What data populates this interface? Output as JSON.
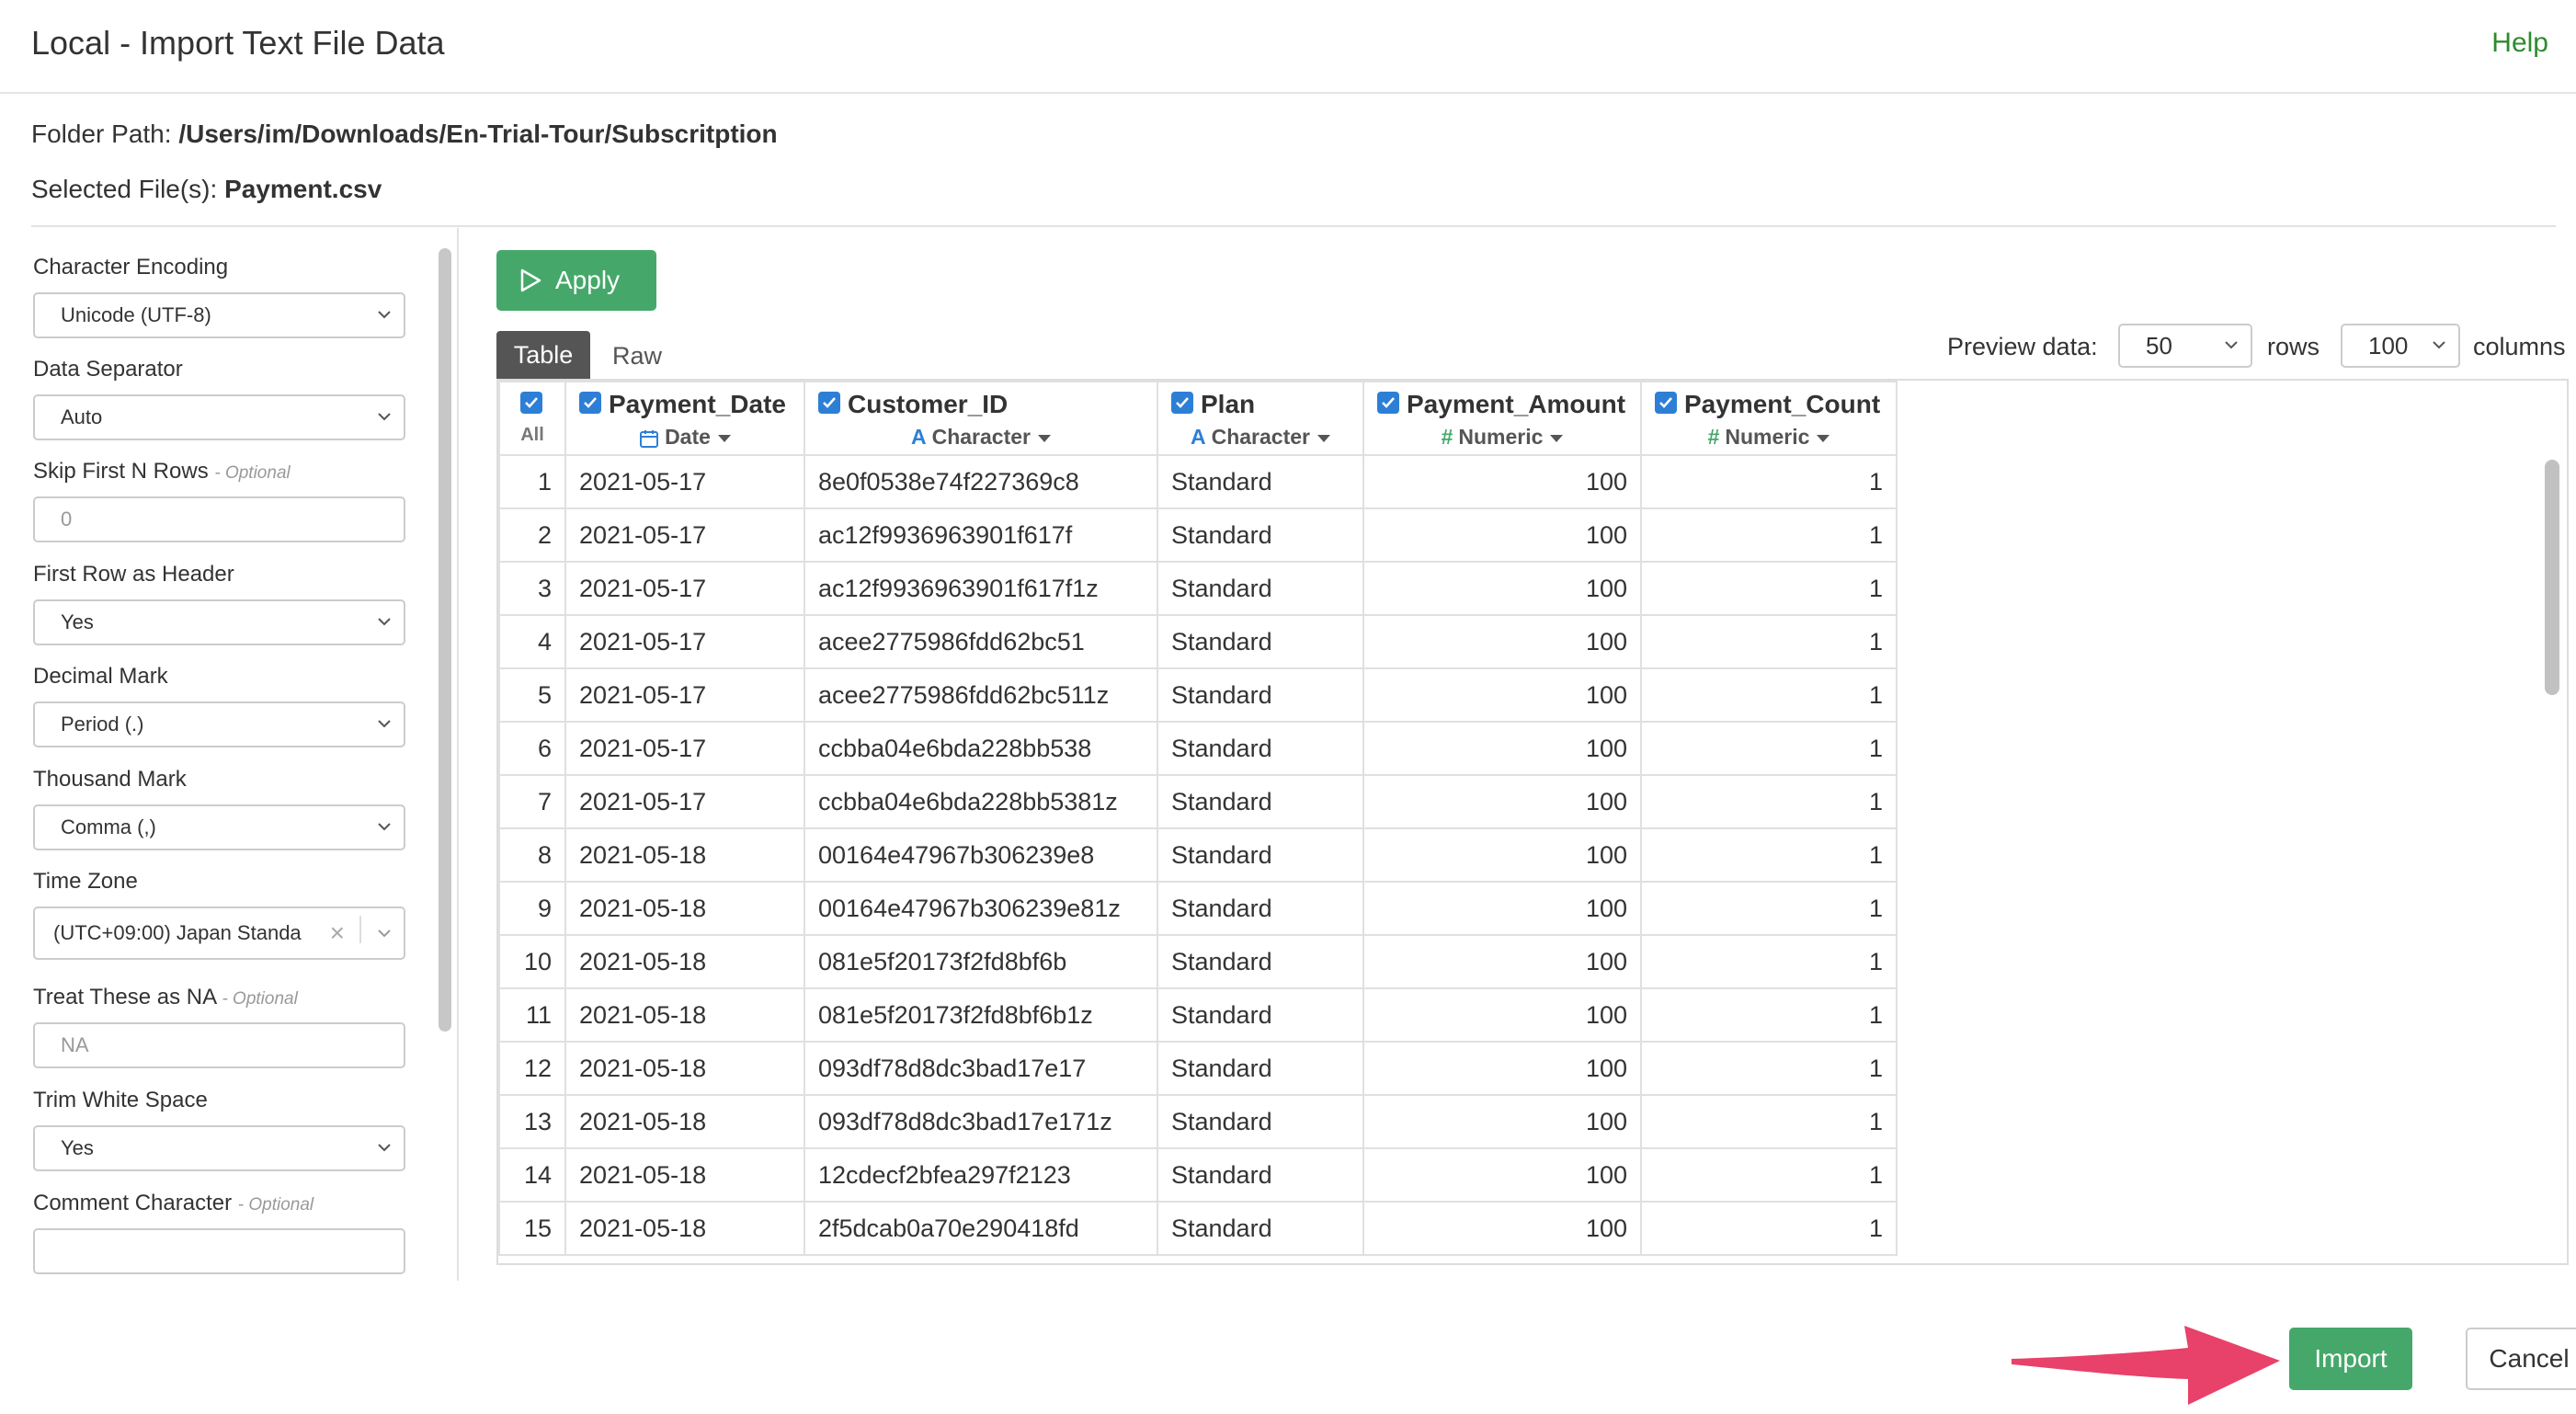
{
  "header": {
    "title": "Local - Import Text File Data",
    "help": "Help"
  },
  "info": {
    "folder_label": "Folder Path:",
    "folder_value": "/Users/im/Downloads/En-Trial-Tour/Subscritption",
    "file_label": "Selected File(s):",
    "file_value": "Payment.csv"
  },
  "options": {
    "encoding": {
      "label": "Character Encoding",
      "value": "Unicode (UTF-8)"
    },
    "separator": {
      "label": "Data Separator",
      "value": "Auto"
    },
    "skip": {
      "label": "Skip First N Rows",
      "optional": "- Optional",
      "placeholder": "0"
    },
    "header_row": {
      "label": "First Row as Header",
      "value": "Yes"
    },
    "decimal": {
      "label": "Decimal Mark",
      "value": "Period (.)"
    },
    "thousand": {
      "label": "Thousand Mark",
      "value": "Comma (,)"
    },
    "timezone": {
      "label": "Time Zone",
      "value": "(UTC+09:00) Japan Standa"
    },
    "na": {
      "label": "Treat These as NA",
      "optional": "- Optional",
      "placeholder": "NA"
    },
    "trim": {
      "label": "Trim White Space",
      "value": "Yes"
    },
    "comment": {
      "label": "Comment Character",
      "optional": "- Optional",
      "placeholder": ""
    }
  },
  "toolbar": {
    "apply": "Apply",
    "tab_table": "Table",
    "tab_raw": "Raw"
  },
  "preview": {
    "label": "Preview data:",
    "rows_value": "50",
    "rows_label": "rows",
    "cols_value": "100",
    "cols_label": "columns"
  },
  "grid": {
    "all_label": "All",
    "columns": [
      {
        "name": "Payment_Date",
        "type": "Date",
        "icon": "calendar-icon"
      },
      {
        "name": "Customer_ID",
        "type": "Character",
        "icon": "character-type-icon"
      },
      {
        "name": "Plan",
        "type": "Character",
        "icon": "character-type-icon"
      },
      {
        "name": "Payment_Amount",
        "type": "Numeric",
        "icon": "numeric-type-icon"
      },
      {
        "name": "Payment_Count",
        "type": "Numeric",
        "icon": "numeric-type-icon"
      }
    ],
    "rows": [
      [
        "1",
        "2021-05-17",
        "8e0f0538e74f227369c8",
        "Standard",
        "100",
        "1"
      ],
      [
        "2",
        "2021-05-17",
        "ac12f9936963901f617f",
        "Standard",
        "100",
        "1"
      ],
      [
        "3",
        "2021-05-17",
        "ac12f9936963901f617f1z",
        "Standard",
        "100",
        "1"
      ],
      [
        "4",
        "2021-05-17",
        "acee2775986fdd62bc51",
        "Standard",
        "100",
        "1"
      ],
      [
        "5",
        "2021-05-17",
        "acee2775986fdd62bc511z",
        "Standard",
        "100",
        "1"
      ],
      [
        "6",
        "2021-05-17",
        "ccbba04e6bda228bb538",
        "Standard",
        "100",
        "1"
      ],
      [
        "7",
        "2021-05-17",
        "ccbba04e6bda228bb5381z",
        "Standard",
        "100",
        "1"
      ],
      [
        "8",
        "2021-05-18",
        "00164e47967b306239e8",
        "Standard",
        "100",
        "1"
      ],
      [
        "9",
        "2021-05-18",
        "00164e47967b306239e81z",
        "Standard",
        "100",
        "1"
      ],
      [
        "10",
        "2021-05-18",
        "081e5f20173f2fd8bf6b",
        "Standard",
        "100",
        "1"
      ],
      [
        "11",
        "2021-05-18",
        "081e5f20173f2fd8bf6b1z",
        "Standard",
        "100",
        "1"
      ],
      [
        "12",
        "2021-05-18",
        "093df78d8dc3bad17e17",
        "Standard",
        "100",
        "1"
      ],
      [
        "13",
        "2021-05-18",
        "093df78d8dc3bad17e171z",
        "Standard",
        "100",
        "1"
      ],
      [
        "14",
        "2021-05-18",
        "12cdecf2bfea297f2123",
        "Standard",
        "100",
        "1"
      ],
      [
        "15",
        "2021-05-18",
        "2f5dcab0a70e290418fd",
        "Standard",
        "100",
        "1"
      ]
    ]
  },
  "footer": {
    "import": "Import",
    "cancel": "Cancel"
  },
  "colors": {
    "accent_green": "#45a86a",
    "help_green": "#2e8b2e",
    "checkbox_blue": "#2d7fd6",
    "arrow_pink": "#e8416a"
  }
}
